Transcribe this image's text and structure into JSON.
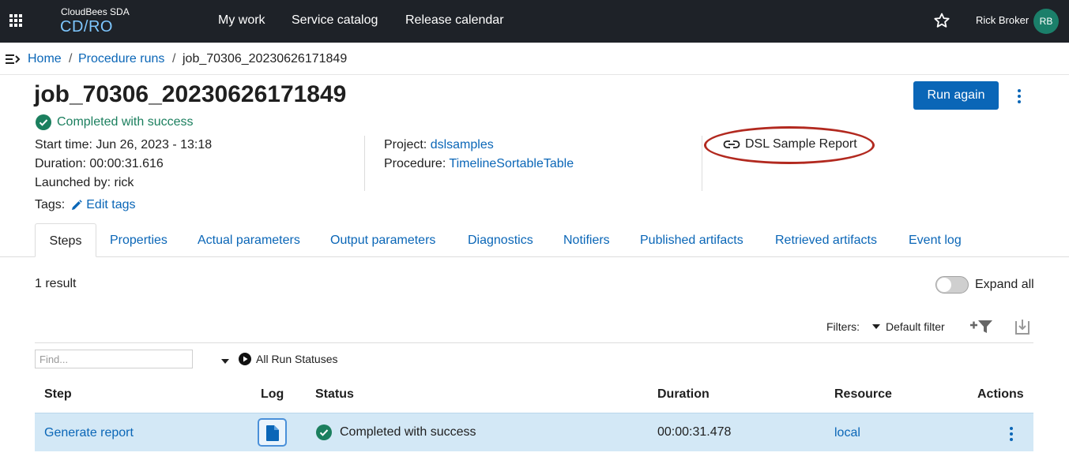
{
  "topbar": {
    "brand_top": "CloudBees SDA",
    "brand_bottom": "CD/RO",
    "nav": [
      "My work",
      "Service catalog",
      "Release calendar"
    ],
    "user_name": "Rick Broker",
    "avatar_initials": "RB",
    "avatar_color": "#1b7f6a",
    "icons": [
      "apps-grid-icon",
      "star-icon"
    ]
  },
  "breadcrumb": {
    "items": [
      "Home",
      "Procedure runs",
      "job_70306_20230626171849"
    ],
    "separator": "/"
  },
  "header": {
    "title": "job_70306_20230626171849",
    "status": "Completed with success",
    "start_label": "Start time:",
    "start_value": "Jun 26, 2023 - 13:18",
    "duration_label": "Duration:",
    "duration_value": "00:00:31.616",
    "launched_label": "Launched by:",
    "launched_value": "rick",
    "tags_label": "Tags:",
    "edit_tags": "Edit tags",
    "project_label": "Project:",
    "project_value": "dslsamples",
    "procedure_label": "Procedure:",
    "procedure_value": "TimelineSortableTable",
    "report_link": "DSL Sample Report",
    "run_again": "Run again"
  },
  "tabs": [
    "Steps",
    "Properties",
    "Actual parameters",
    "Output parameters",
    "Diagnostics",
    "Notifiers",
    "Published artifacts",
    "Retrieved artifacts",
    "Event log"
  ],
  "steps": {
    "result_count": "1 result",
    "expand_all": "Expand all",
    "filters_label": "Filters:",
    "filter_value": "Default filter",
    "find_placeholder": "Find...",
    "run_status_filter": "All Run Statuses",
    "columns": [
      "Step",
      "Log",
      "Status",
      "Duration",
      "Resource",
      "Actions"
    ],
    "rows": [
      {
        "step": "Generate report",
        "status": "Completed with success",
        "duration": "00:00:31.478",
        "resource": "local"
      }
    ]
  },
  "colors": {
    "accent": "#0a66b7",
    "success": "#1b7f5e",
    "topbar": "#1e2228",
    "highlight": "#b2291f",
    "row_selected": "#d3e8f6"
  }
}
